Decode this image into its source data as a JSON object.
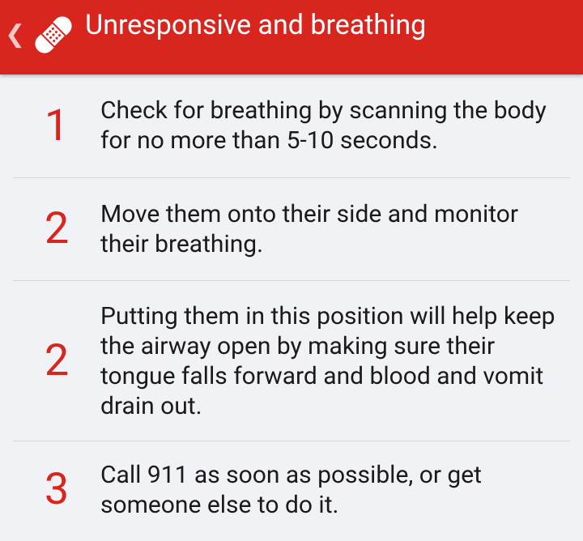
{
  "header": {
    "title": "Unresponsive and breathing",
    "back_icon": "chevron-left-icon",
    "app_icon": "bandage-icon",
    "background_color": "#d8261f",
    "text_color": "#ffffff"
  },
  "steps": [
    {
      "number": "1",
      "text": "Check for breathing by scanning the body for no more than 5-10 seconds."
    },
    {
      "number": "2",
      "text": "Move them onto their side and monitor their breathing."
    },
    {
      "number": "2",
      "text": "Putting them in this position will help keep the airway open by making sure their tongue falls forward and blood and vomit drain out."
    },
    {
      "number": "3",
      "text": "Call 911 as soon as possible, or get someone else to do it."
    }
  ],
  "colors": {
    "accent": "#d8261f",
    "background": "#f1f2f6",
    "divider": "#d6d7db",
    "body_text": "#1a1a1a"
  }
}
